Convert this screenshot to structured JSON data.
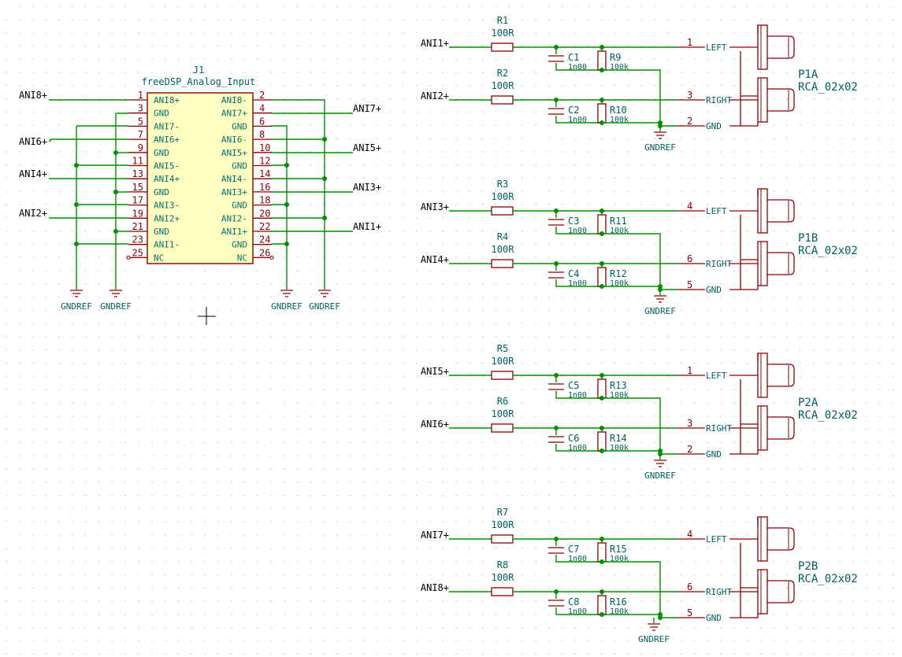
{
  "j1": {
    "ref": "J1",
    "value": "freeDSP_Analog_Input",
    "left_pins": [
      {
        "num": "1",
        "name": "ANI8+"
      },
      {
        "num": "3",
        "name": "GND"
      },
      {
        "num": "5",
        "name": "ANI7-"
      },
      {
        "num": "7",
        "name": "ANI6+"
      },
      {
        "num": "9",
        "name": "GND"
      },
      {
        "num": "11",
        "name": "ANI5-"
      },
      {
        "num": "13",
        "name": "ANI4+"
      },
      {
        "num": "15",
        "name": "GND"
      },
      {
        "num": "17",
        "name": "ANI3-"
      },
      {
        "num": "19",
        "name": "ANI2+"
      },
      {
        "num": "21",
        "name": "GND"
      },
      {
        "num": "23",
        "name": "ANI1-"
      },
      {
        "num": "25",
        "name": "NC"
      }
    ],
    "right_pins": [
      {
        "num": "2",
        "name": "ANI8-"
      },
      {
        "num": "4",
        "name": "ANI7+"
      },
      {
        "num": "6",
        "name": "GND"
      },
      {
        "num": "8",
        "name": "ANI6-"
      },
      {
        "num": "10",
        "name": "ANI5+"
      },
      {
        "num": "12",
        "name": "GND"
      },
      {
        "num": "14",
        "name": "ANI4-"
      },
      {
        "num": "16",
        "name": "ANI3+"
      },
      {
        "num": "18",
        "name": "GND"
      },
      {
        "num": "20",
        "name": "ANI2-"
      },
      {
        "num": "22",
        "name": "ANI1+"
      },
      {
        "num": "24",
        "name": "GND"
      },
      {
        "num": "26",
        "name": "NC"
      }
    ],
    "left_labels": [
      "ANI8+",
      "ANI6+",
      "ANI4+",
      "ANI2+"
    ],
    "right_labels": [
      "ANI7+",
      "ANI5+",
      "ANI3+",
      "ANI1+"
    ],
    "gnd_labels": [
      "GNDREF",
      "GNDREF",
      "GNDREF",
      "GNDREF"
    ]
  },
  "blocks": [
    {
      "conn_ref": "P1A",
      "conn_value": "RCA_02x02",
      "gnd": "GNDREF",
      "ch": [
        {
          "label": "ANI1+",
          "r_ref": "R1",
          "r_val": "100R",
          "c_ref": "C1",
          "c_val": "1n00",
          "rp_ref": "R9",
          "rp_val": "100k",
          "pin": "1",
          "name": "LEFT"
        },
        {
          "label": "ANI2+",
          "r_ref": "R2",
          "r_val": "100R",
          "c_ref": "C2",
          "c_val": "1n00",
          "rp_ref": "R10",
          "rp_val": "100k",
          "pin": "3",
          "name": "RIGHT"
        }
      ],
      "gnd_pin": "2",
      "gnd_name": "GND"
    },
    {
      "conn_ref": "P1B",
      "conn_value": "RCA_02x02",
      "gnd": "GNDREF",
      "ch": [
        {
          "label": "ANI3+",
          "r_ref": "R3",
          "r_val": "100R",
          "c_ref": "C3",
          "c_val": "1n00",
          "rp_ref": "R11",
          "rp_val": "100k",
          "pin": "4",
          "name": "LEFT"
        },
        {
          "label": "ANI4+",
          "r_ref": "R4",
          "r_val": "100R",
          "c_ref": "C4",
          "c_val": "1n00",
          "rp_ref": "R12",
          "rp_val": "100k",
          "pin": "6",
          "name": "RIGHT"
        }
      ],
      "gnd_pin": "5",
      "gnd_name": "GND"
    },
    {
      "conn_ref": "P2A",
      "conn_value": "RCA_02x02",
      "gnd": "GNDREF",
      "ch": [
        {
          "label": "ANI5+",
          "r_ref": "R5",
          "r_val": "100R",
          "c_ref": "C5",
          "c_val": "1n00",
          "rp_ref": "R13",
          "rp_val": "100k",
          "pin": "1",
          "name": "LEFT"
        },
        {
          "label": "ANI6+",
          "r_ref": "R6",
          "r_val": "100R",
          "c_ref": "C6",
          "c_val": "1n00",
          "rp_ref": "R14",
          "rp_val": "100k",
          "pin": "3",
          "name": "RIGHT"
        }
      ],
      "gnd_pin": "2",
      "gnd_name": "GND"
    },
    {
      "conn_ref": "P2B",
      "conn_value": "RCA_02x02",
      "gnd": "GNDREF",
      "ch": [
        {
          "label": "ANI7+",
          "r_ref": "R7",
          "r_val": "100R",
          "c_ref": "C7",
          "c_val": "1n00",
          "rp_ref": "R15",
          "rp_val": "100k",
          "pin": "4",
          "name": "LEFT"
        },
        {
          "label": "ANI8+",
          "r_ref": "R8",
          "r_val": "100R",
          "c_ref": "C8",
          "c_val": "1n00",
          "rp_ref": "R16",
          "rp_val": "100k",
          "pin": "6",
          "name": "RIGHT"
        }
      ],
      "gnd_pin": "5",
      "gnd_name": "GND"
    }
  ],
  "colors": {
    "wire": "#009000",
    "pin": "#8b0000",
    "body_fill": "#ffffc2",
    "text": "#005f5f",
    "grid_dot": "#c8c8c8"
  }
}
